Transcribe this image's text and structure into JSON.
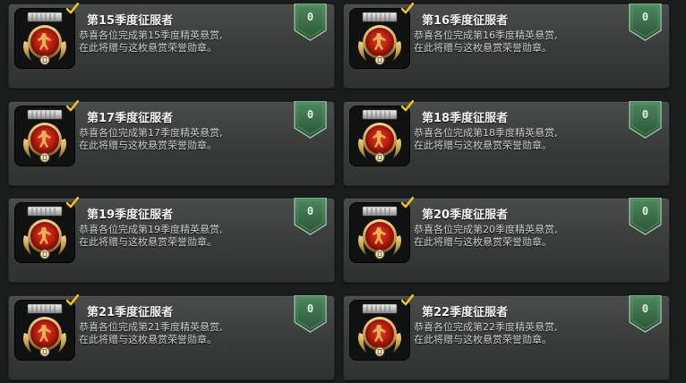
{
  "colors": {
    "card_bg": "#3d3f3f",
    "title_text": "#f4f4f4",
    "desc_text": "#d0d0d0",
    "badge_green": "#3a6a48",
    "check_yellow": "#f2c21a",
    "medal_red": "#b81b10",
    "medal_gold": "#c9a24e"
  },
  "icons": {
    "medal": "season-conqueror-medal-icon",
    "check": "checkmark-icon",
    "badge": "shield-badge-icon"
  },
  "achievements": [
    {
      "title": "第15季度征服者",
      "desc_line1": "恭喜各位完成第15季度精英悬赏,",
      "desc_line2": "在此将赠与这枚悬赏荣誉勋章。",
      "count": "0"
    },
    {
      "title": "第16季度征服者",
      "desc_line1": "恭喜各位完成第16季度精英悬赏,",
      "desc_line2": "在此将赠与这枚悬赏荣誉勋章。",
      "count": "0"
    },
    {
      "title": "第17季度征服者",
      "desc_line1": "恭喜各位完成第17季度精英悬赏,",
      "desc_line2": "在此将赠与这枚悬赏荣誉勋章。",
      "count": "0"
    },
    {
      "title": "第18季度征服者",
      "desc_line1": "恭喜各位完成第18季度精英悬赏,",
      "desc_line2": "在此将赠与这枚悬赏荣誉勋章。",
      "count": "0"
    },
    {
      "title": "第19季度征服者",
      "desc_line1": "恭喜各位完成第19季度精英悬赏,",
      "desc_line2": "在此将赠与这枚悬赏荣誉勋章。",
      "count": "0"
    },
    {
      "title": "第20季度征服者",
      "desc_line1": "恭喜各位完成第20季度精英悬赏,",
      "desc_line2": "在此将赠与这枚悬赏荣誉勋章。",
      "count": "0"
    },
    {
      "title": "第21季度征服者",
      "desc_line1": "恭喜各位完成第21季度精英悬赏,",
      "desc_line2": "在此将赠与这枚悬赏荣誉勋章。",
      "count": "0"
    },
    {
      "title": "第22季度征服者",
      "desc_line1": "恭喜各位完成第22季度精英悬赏,",
      "desc_line2": "在此将赠与这枚悬赏荣誉勋章。",
      "count": "0"
    }
  ]
}
